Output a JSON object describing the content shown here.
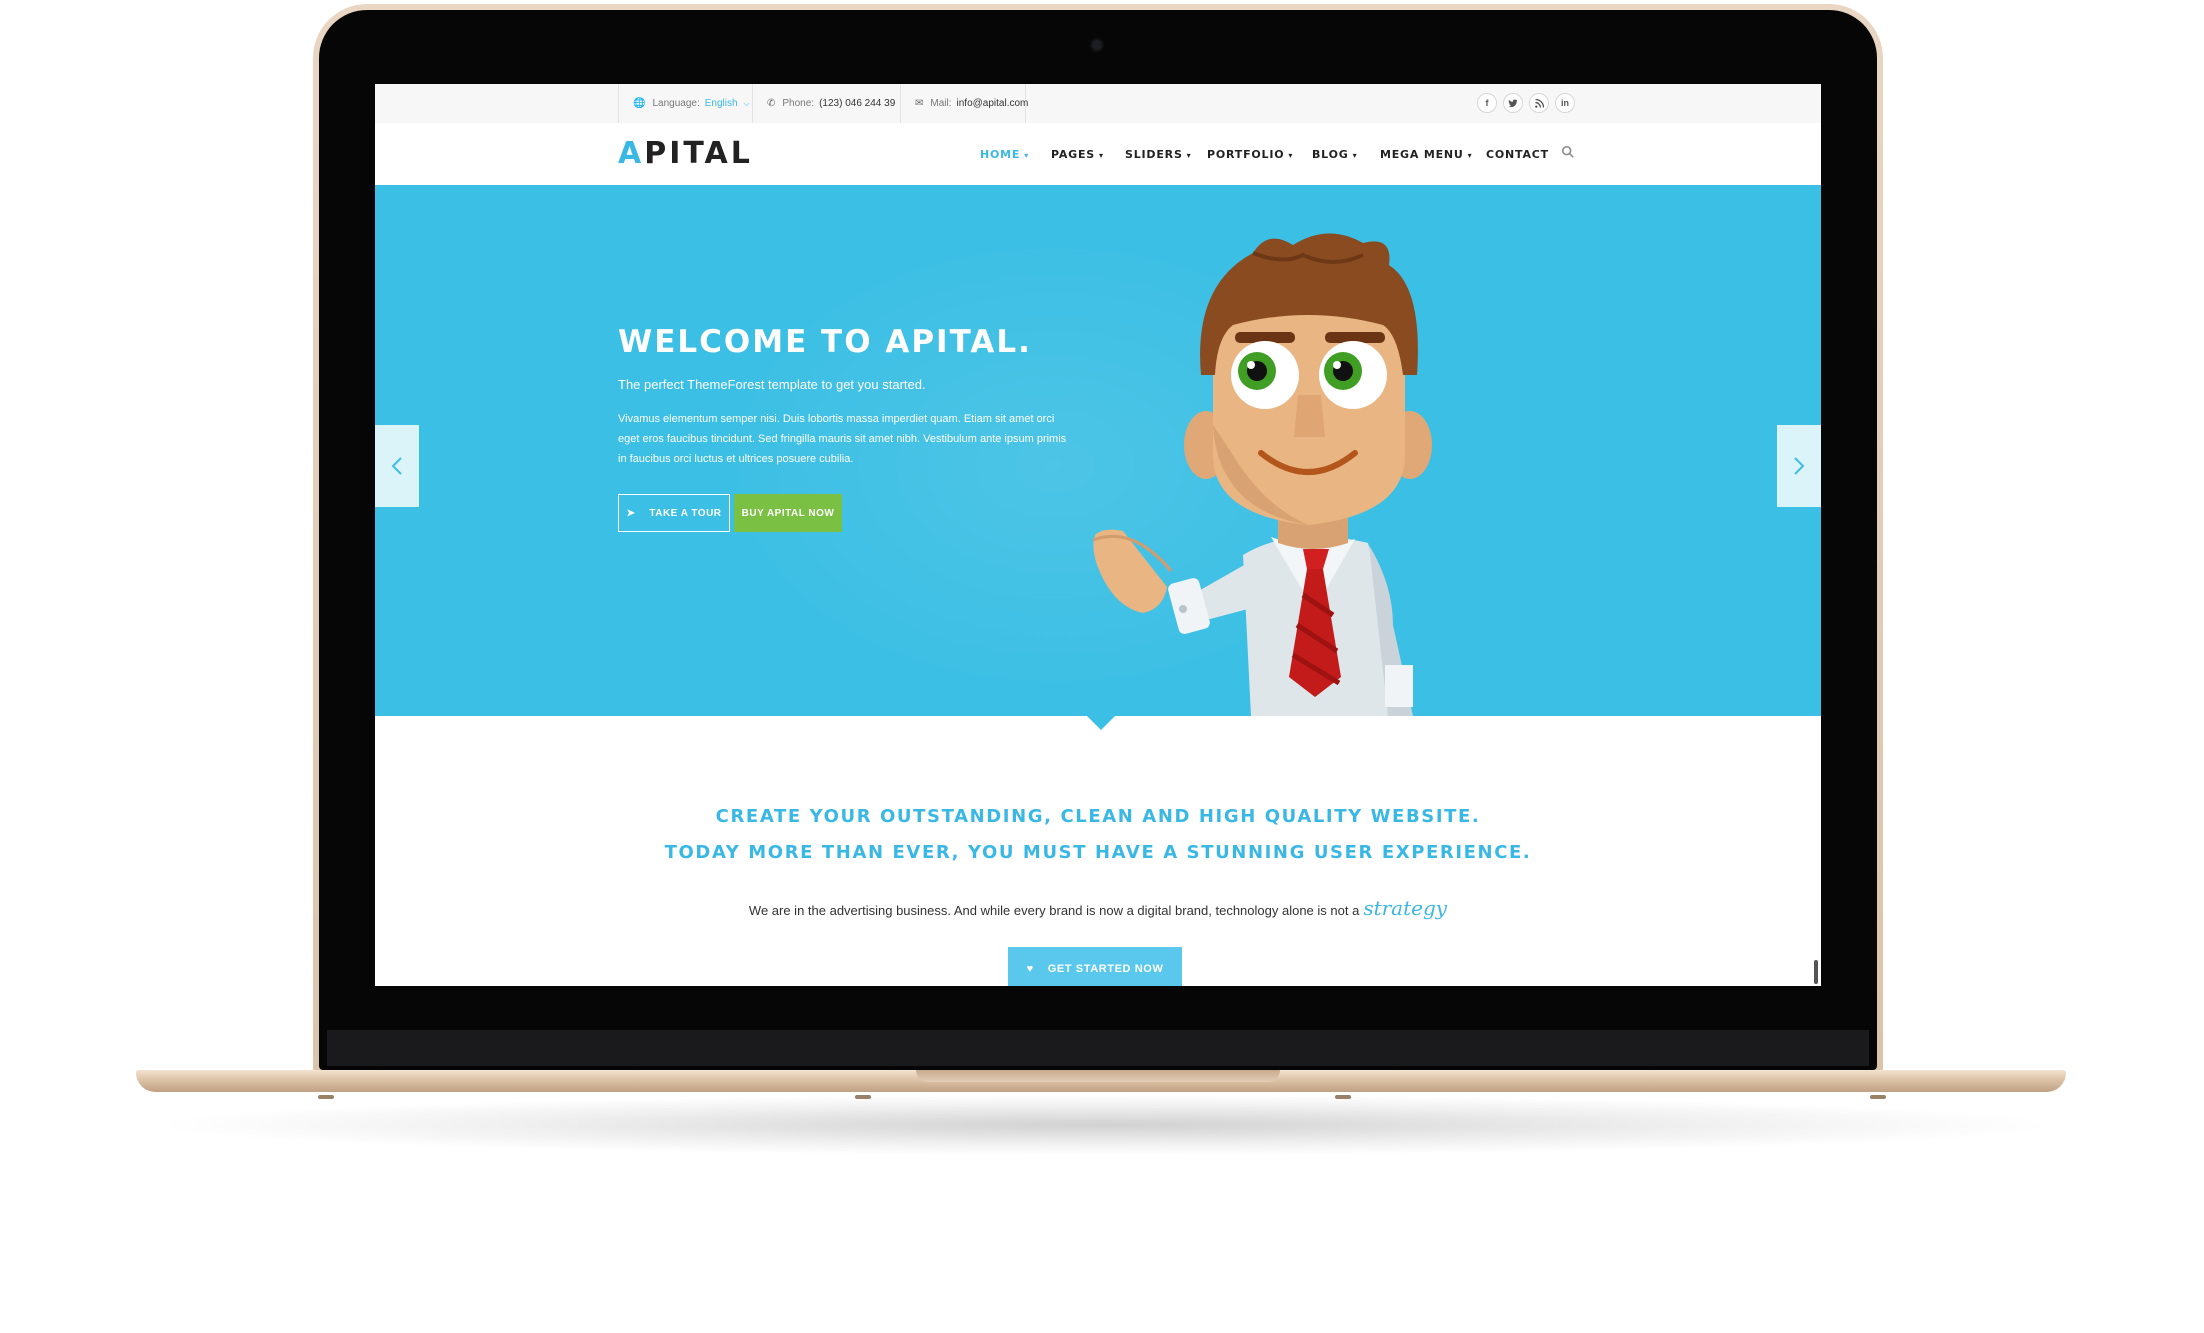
{
  "topbar": {
    "language_label": "Language:",
    "language_value": "English",
    "phone_label": "Phone:",
    "phone_value": "(123) 046 244 39",
    "mail_label": "Mail:",
    "mail_value": "info@apital.com",
    "social": [
      {
        "icon": "facebook-icon",
        "glyph": "f"
      },
      {
        "icon": "twitter-icon",
        "glyph": "t"
      },
      {
        "icon": "rss-icon",
        "glyph": "⁾"
      },
      {
        "icon": "linkedin-icon",
        "glyph": "in"
      }
    ]
  },
  "header": {
    "logo_first": "A",
    "logo_rest": "PITAL",
    "nav": [
      {
        "label": "HOME",
        "active": true,
        "has_dropdown": true
      },
      {
        "label": "PAGES",
        "has_dropdown": true
      },
      {
        "label": "SLIDERS",
        "has_dropdown": true
      },
      {
        "label": "PORTFOLIO",
        "has_dropdown": true
      },
      {
        "label": "BLOG",
        "has_dropdown": true
      },
      {
        "label": "MEGA MENU",
        "has_dropdown": true
      },
      {
        "label": "CONTACT",
        "has_dropdown": false
      }
    ]
  },
  "hero": {
    "title": "WELCOME TO APITAL.",
    "subtitle": "The perfect ThemeForest template to get you started.",
    "body": "Vivamus elementum semper nisi. Duis lobortis massa imperdiet quam. Etiam sit amet orci eget eros faucibus tincidunt. Sed fringilla mauris sit amet nibh. Vestibulum ante ipsum primis in faucibus orci luctus et ultrices posuere cubilia.",
    "tour_button": "TAKE A TOUR",
    "buy_button": "BUY APITAL NOW",
    "background_color": "#3bbfe4"
  },
  "promo": {
    "line1": "CREATE YOUR OUTSTANDING, CLEAN AND HIGH QUALITY WEBSITE.",
    "line2": "TODAY MORE THAN EVER, YOU MUST HAVE A STUNNING USER EXPERIENCE.",
    "text": "We are in the advertising business. And while every brand is now a digital brand, technology alone is not a",
    "script_word": "strategy",
    "cta": "GET STARTED NOW"
  },
  "colors": {
    "accent": "#3ab8e5",
    "buy_green": "#79c043",
    "cta_blue": "#5ac8ec"
  }
}
